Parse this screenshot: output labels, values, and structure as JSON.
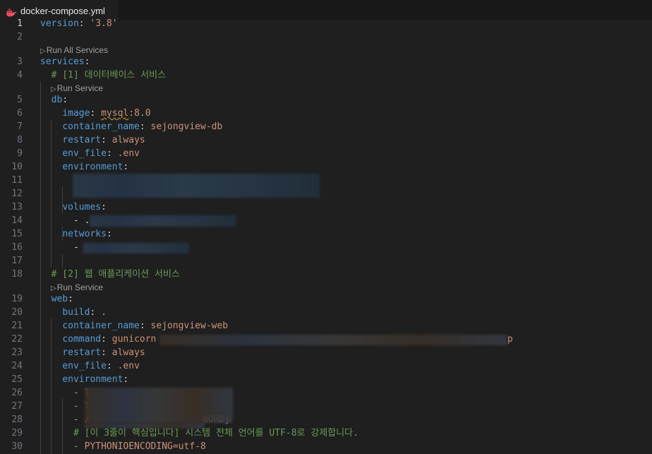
{
  "tab": {
    "filename": "docker-compose.yml",
    "icon": "docker-whale-icon"
  },
  "colors": {
    "key": "#569cd6",
    "string": "#ce9178",
    "number": "#b5cea8",
    "comment": "#6a9955",
    "text": "#cccccc"
  },
  "codelens": {
    "run_all": "Run All Services",
    "run_service_db": "Run Service",
    "run_service_web": "Run Service"
  },
  "lines": [
    {
      "n": "1",
      "text": "version: '3.8'"
    },
    {
      "n": "2",
      "text": ""
    },
    {
      "n": "3",
      "text": "services:"
    },
    {
      "n": "4",
      "text": "  # [1] 데이터베이스 서비스"
    },
    {
      "n": "5",
      "text": "  db:"
    },
    {
      "n": "6",
      "text": "    image: mysql:8.0"
    },
    {
      "n": "7",
      "text": "    container_name: sejongview-db"
    },
    {
      "n": "8",
      "text": "    restart: always"
    },
    {
      "n": "9",
      "text": "    env_file: .env"
    },
    {
      "n": "10",
      "text": "    environment:"
    },
    {
      "n": "11",
      "text": ""
    },
    {
      "n": "12",
      "text": ""
    },
    {
      "n": "13",
      "text": "    volumes:"
    },
    {
      "n": "14",
      "text": "      - ."
    },
    {
      "n": "15",
      "text": "    networks:"
    },
    {
      "n": "16",
      "text": "      -"
    },
    {
      "n": "17",
      "text": ""
    },
    {
      "n": "18",
      "text": "  # [2] 웹 애플리케이션 서비스"
    },
    {
      "n": "19",
      "text": "  web:"
    },
    {
      "n": "20",
      "text": "    build: ."
    },
    {
      "n": "21",
      "text": "    container_name: sejongview-web"
    },
    {
      "n": "22",
      "text": "    command: gunicorn"
    },
    {
      "n": "23",
      "text": "    restart: always"
    },
    {
      "n": "24",
      "text": "    env_file: .env"
    },
    {
      "n": "25",
      "text": "    environment:"
    },
    {
      "n": "26",
      "text": "      -"
    },
    {
      "n": "27",
      "text": "      -"
    },
    {
      "n": "28",
      "text": "      -"
    },
    {
      "n": "29",
      "text": "      # [이 3줄이 핵심입니다] 시스템 전체 언어를 UTF-8로 강제합니다."
    },
    {
      "n": "30",
      "text": "      - PYTHONIOENCODING=utf-8"
    }
  ],
  "fragments": {
    "l1_key": "version",
    "l1_val": "'3.8'",
    "l3_key": "services",
    "l4_comment": "# [1] 데이터베이스 서비스",
    "l5_key": "db",
    "l6_key": "image",
    "l6_val_a": "mysql",
    "l6_val_b": ":8.0",
    "l7_key": "container_name",
    "l7_val": "sejongview-db",
    "l8_key": "restart",
    "l8_val": "always",
    "l9_key": "env_file",
    "l9_val": ".env",
    "l10_key": "environment",
    "l13_key": "volumes",
    "l14_dash": "- .",
    "l15_key": "networks",
    "l16_dash": "-",
    "l18_comment": "# [2] 웹 애플리케이션 서비스",
    "l19_key": "web",
    "l20_key": "build",
    "l20_val": ".",
    "l21_key": "container_name",
    "l21_val": "sejongview-web",
    "l22_key": "command",
    "l22_val": "gunicorn",
    "l22_tail": "p",
    "l23_key": "restart",
    "l23_val": "always",
    "l24_key": "env_file",
    "l24_val": ".env",
    "l25_key": "environment",
    "l26_dash": "- l",
    "l27_dash": "- l",
    "l28_dash": "- /",
    "l28_tail": "WORD}",
    "l29_comment": "# [이 3줄이 핵심입니다] 시스템 전체 언어를 UTF-8로 강제합니다.",
    "l30_dash": "- PYTHONIOENCODING=utf-8"
  }
}
